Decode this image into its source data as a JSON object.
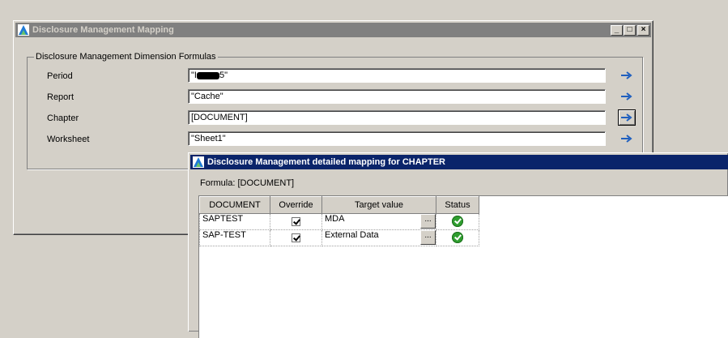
{
  "main_window": {
    "title": "Disclosure Management Mapping",
    "group_title": "Disclosure Management Dimension Formulas",
    "fields": [
      {
        "label": "Period",
        "value": "\"I",
        "value_suffix": "5\""
      },
      {
        "label": "Report",
        "value": "\"Cache\""
      },
      {
        "label": "Chapter",
        "value": "[DOCUMENT]"
      },
      {
        "label": "Worksheet",
        "value": "\"Sheet1\""
      }
    ],
    "caption_buttons": {
      "minimize": "_",
      "maximize": "□",
      "close": "×"
    }
  },
  "detail_window": {
    "title": "Disclosure Management detailed mapping for CHAPTER",
    "formula_text": "Formula: [DOCUMENT]",
    "columns": [
      "DOCUMENT",
      "Override",
      "Target value",
      "Status"
    ],
    "rows": [
      {
        "document": "SAPTEST",
        "override": true,
        "target": "MDA",
        "browse": "...",
        "status": "ok"
      },
      {
        "document": "SAP-TEST",
        "override": true,
        "target": "External Data",
        "browse": "...",
        "status": "ok"
      }
    ]
  },
  "colors": {
    "dialog_bg": "#d4d0c8",
    "active_title": "#0a246a",
    "inactive_title": "#808080",
    "arrow": "#1f5fbf",
    "status_ok": "#2f9e2f"
  },
  "icons": {
    "app": "sap-app-icon",
    "go": "arrow-right-icon",
    "status": "check-circle-icon"
  }
}
